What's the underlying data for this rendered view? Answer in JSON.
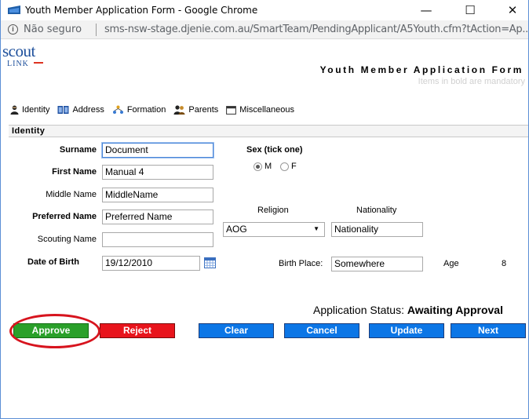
{
  "window": {
    "title": "Youth Member Application Form - Google Chrome",
    "minimize": "—",
    "maximize": "☐",
    "close": "✕"
  },
  "address": {
    "not_secure": "Não seguro",
    "url": "sms-nsw-stage.djenie.com.au/SmartTeam/PendingApplicant/A5Youth.cfm?tAction=Ap..."
  },
  "header": {
    "logo_top": "scout",
    "logo_bottom": "LINK",
    "title": "Youth Member Application Form",
    "mandatory_note": "Items in bold are mandatory"
  },
  "tabs": [
    {
      "label": "Identity"
    },
    {
      "label": "Address"
    },
    {
      "label": "Formation"
    },
    {
      "label": "Parents"
    },
    {
      "label": "Miscellaneous"
    }
  ],
  "section": {
    "title": "Identity"
  },
  "form": {
    "surname_label": "Surname",
    "surname_value": "Document",
    "firstname_label": "First Name",
    "firstname_value": "Manual 4",
    "middlename_label": "Middle Name",
    "middlename_value": "MiddleName",
    "preferred_label": "Preferred Name",
    "preferred_value": "Preferred Name",
    "scouting_label": "Scouting Name",
    "scouting_value": "",
    "dob_label": "Date of Birth",
    "dob_value": "19/12/2010",
    "sex_label": "Sex (tick one)",
    "sex_m": "M",
    "sex_f": "F",
    "religion_label": "Religion",
    "religion_value": "AOG",
    "nationality_label": "Nationality",
    "nationality_value": "Nationality",
    "birthplace_label": "Birth Place:",
    "birthplace_value": "Somewhere",
    "age_label": "Age",
    "age_value": "8"
  },
  "status": {
    "label": "Application Status:",
    "value": "Awaiting Approval"
  },
  "buttons": {
    "approve": "Approve",
    "reject": "Reject",
    "clear": "Clear",
    "cancel": "Cancel",
    "update": "Update",
    "next": "Next"
  },
  "colors": {
    "approve": "#2aa02a",
    "reject": "#e8141c",
    "action": "#0c76e6",
    "highlight_circle": "#d7141e"
  }
}
